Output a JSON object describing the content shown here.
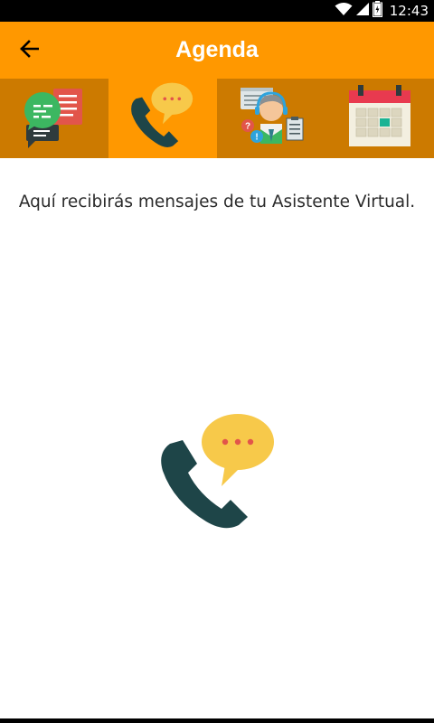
{
  "status_bar": {
    "time": "12:43",
    "icons": [
      "wifi-icon",
      "signal-icon",
      "battery-icon"
    ]
  },
  "app_bar": {
    "title": "Agenda",
    "back_icon": "back-arrow-icon",
    "color": "#ff9800"
  },
  "tabs": [
    {
      "name": "chat-messages-icon",
      "active": false
    },
    {
      "name": "phone-call-icon",
      "active": true
    },
    {
      "name": "virtual-assistant-icon",
      "active": false
    },
    {
      "name": "calendar-icon",
      "active": false
    }
  ],
  "content": {
    "message": "Aquí recibirás mensajes de tu Asistente Virtual.",
    "hero_icon": "phone-call-icon"
  },
  "colors": {
    "accent": "#ff9800",
    "tab_bar_dark": "#cc7a00",
    "phone": "#1e4548",
    "bubble": "#f7c94a"
  }
}
